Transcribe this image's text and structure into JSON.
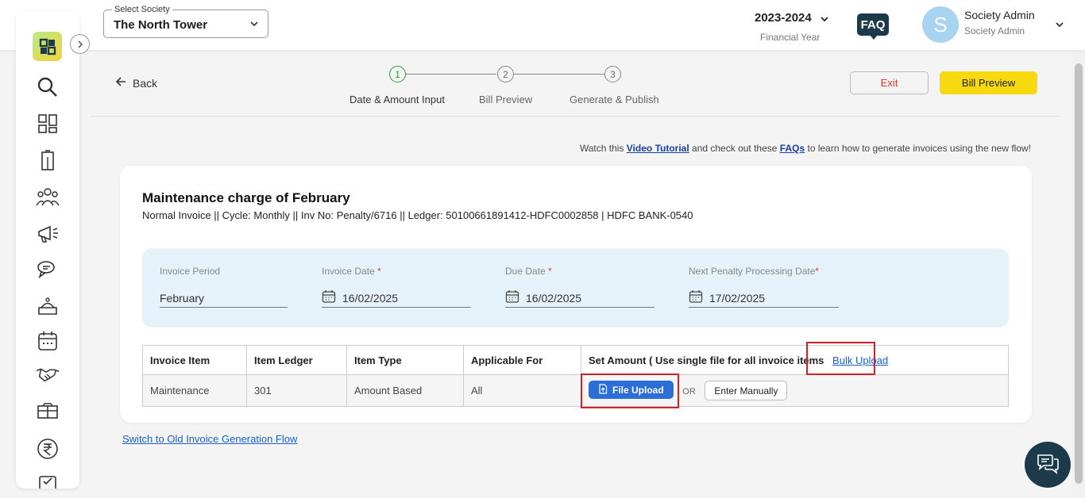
{
  "header": {
    "society_label": "Select Society",
    "society_value": "The North Tower",
    "financial_year": "2023-2024",
    "financial_year_label": "Financial Year",
    "faq_label": "FAQ",
    "avatar_initial": "S",
    "user_name": "Society Admin",
    "user_role": "Society Admin"
  },
  "sidebar": {
    "icons": [
      "search-icon",
      "dashboard-icon",
      "building-icon",
      "members-icon",
      "announcement-icon",
      "chat-icon",
      "facility-icon",
      "calendar-icon",
      "handshake-icon",
      "amenities-icon",
      "rupee-icon",
      "checklist-icon"
    ]
  },
  "toolbar": {
    "back_label": "Back",
    "steps": [
      {
        "number": "1",
        "label": "Date & Amount Input",
        "active": true
      },
      {
        "number": "2",
        "label": "Bill Preview",
        "active": false
      },
      {
        "number": "3",
        "label": "Generate & Publish",
        "active": false
      }
    ],
    "exit_label": "Exit",
    "preview_label": "Bill Preview"
  },
  "tutorial": {
    "prefix": "Watch this",
    "video_link": "Video Tutorial",
    "middle": "and check out these",
    "faq_link": "FAQs",
    "suffix": "to learn how to generate invoices using the new flow!"
  },
  "invoice": {
    "title": "Maintenance charge of February",
    "subtitle": "Normal Invoice || Cycle: Monthly || Inv No: Penalty/6716 || Ledger: 50100661891412-HDFC0002858 | HDFC BANK-0540",
    "fields": {
      "period_label": "Invoice Period",
      "period_value": "February",
      "invoice_date_label": "Invoice Date",
      "invoice_date_value": "16/02/2025",
      "due_date_label": "Due Date",
      "due_date_value": "16/02/2025",
      "penalty_date_label": "Next Penalty Processing Date",
      "penalty_date_value": "17/02/2025",
      "required_mark": "*"
    },
    "table": {
      "headers": [
        "Invoice Item",
        "Item Ledger",
        "Item Type",
        "Applicable For",
        "Set Amount ( Use single file for all invoice items"
      ],
      "bulk_upload_label": "Bulk Upload",
      "row": {
        "item": "Maintenance",
        "ledger": "301",
        "type": "Amount Based",
        "applicable": "All"
      },
      "file_upload_label": "File Upload",
      "or_label": "OR",
      "manual_label": "Enter Manually"
    }
  },
  "footer": {
    "old_flow_link": "Switch to Old Invoice Generation Flow"
  }
}
